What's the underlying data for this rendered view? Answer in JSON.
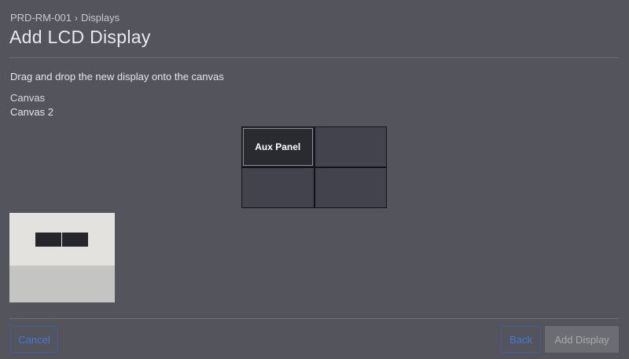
{
  "breadcrumb": {
    "device": "PRD-RM-001",
    "separator": "›",
    "section": "Displays"
  },
  "page": {
    "title": "Add LCD Display"
  },
  "instructions": "Drag and drop the new display onto the canvas",
  "canvas": {
    "label": "Canvas",
    "name": "Canvas 2",
    "cells": [
      {
        "label": "Aux Panel",
        "occupied": true
      },
      {
        "label": "",
        "occupied": false
      },
      {
        "label": "",
        "occupied": false
      },
      {
        "label": "",
        "occupied": false
      }
    ]
  },
  "new_display": {
    "icon": "dual-screen-display-icon"
  },
  "footer": {
    "cancel_label": "Cancel",
    "back_label": "Back",
    "add_label": "Add Display",
    "add_disabled": true
  },
  "colors": {
    "background": "#53545c",
    "link_blue": "#3e7be0",
    "occupied_cell": "#2a2b31",
    "empty_cell": "#42434d"
  }
}
